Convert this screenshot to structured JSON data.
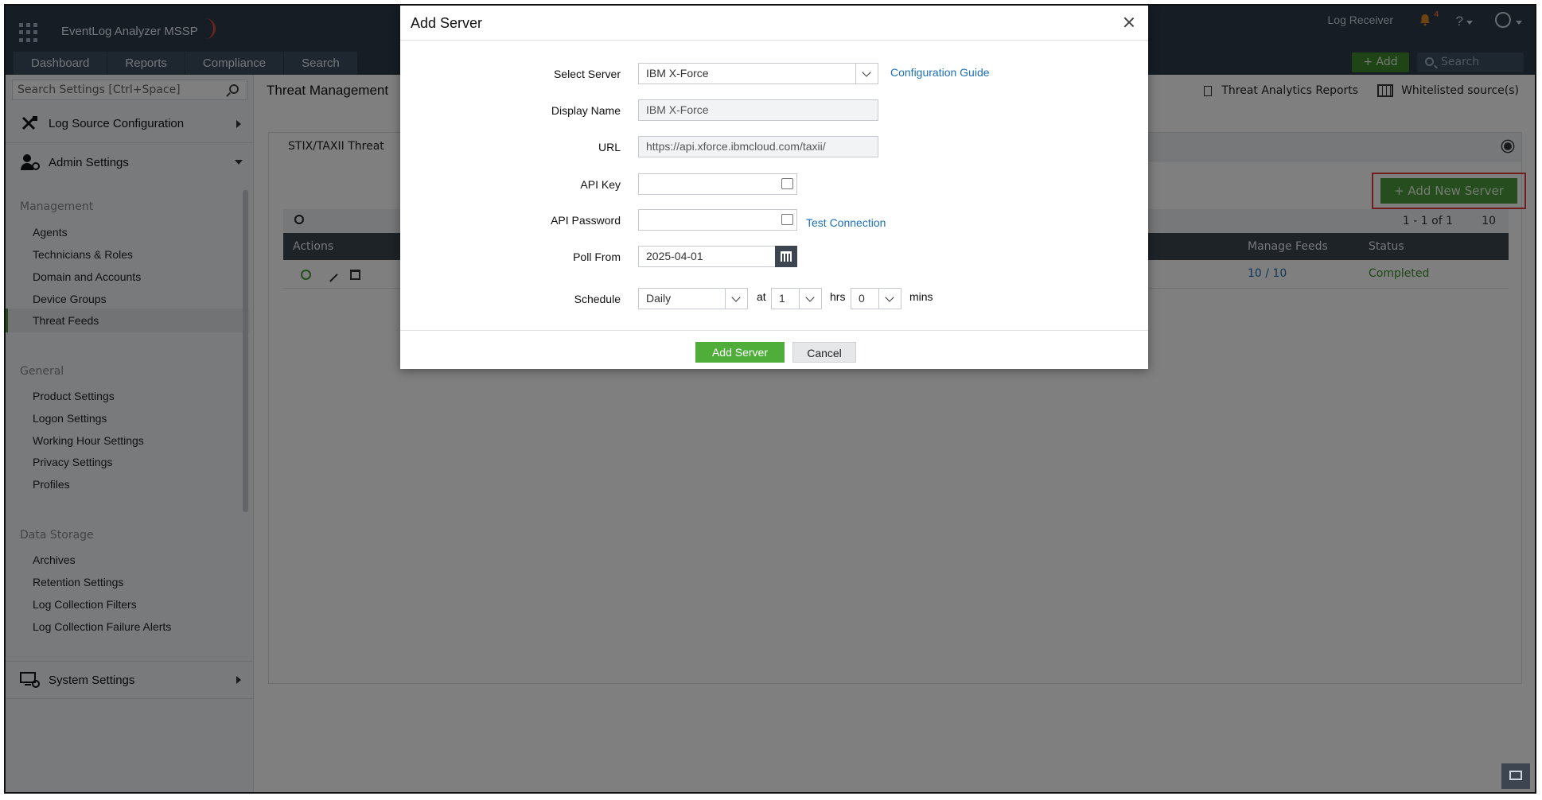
{
  "header": {
    "product": "EventLog Analyzer MSSP",
    "log_receiver": "Log Receiver",
    "notification_count": "4",
    "help": "?",
    "nav_tabs": [
      "Dashboard",
      "Reports",
      "Compliance",
      "Search"
    ],
    "add_label": "+ Add",
    "search_placeholder": "Search"
  },
  "sidebar": {
    "search_placeholder": "Search Settings [Ctrl+Space]",
    "log_source_config": "Log Source Configuration",
    "admin_settings": "Admin Settings",
    "management_title": "Management",
    "management_items": [
      "Agents",
      "Technicians & Roles",
      "Domain and Accounts",
      "Device Groups",
      "Threat Feeds"
    ],
    "general_title": "General",
    "general_items": [
      "Product Settings",
      "Logon Settings",
      "Working Hour Settings",
      "Privacy Settings",
      "Profiles"
    ],
    "data_storage_title": "Data Storage",
    "data_storage_items": [
      "Archives",
      "Retention Settings",
      "Log Collection Filters",
      "Log Collection Failure Alerts"
    ],
    "system_settings": "System Settings",
    "active_item": "Threat Feeds"
  },
  "main": {
    "title": "Threat Management",
    "threat_reports": "Threat Analytics Reports",
    "whitelisted": "Whitelisted source(s)",
    "panel_tab": "STIX/TAXII Threat",
    "add_new_server": "+  Add New Server",
    "pager": "1 - 1 of 1",
    "page_size": "10",
    "columns": {
      "actions": "Actions",
      "manage_feeds": "Manage Feeds",
      "status": "Status"
    },
    "row": {
      "manage_feeds": "10 / 10",
      "status": "Completed"
    }
  },
  "dialog": {
    "title": "Add Server",
    "select_server_label": "Select Server",
    "select_server_value": "IBM X-Force",
    "config_guide": "Configuration Guide",
    "display_name_label": "Display Name",
    "display_name_value": "IBM X-Force",
    "url_label": "URL",
    "url_value": "https://api.xforce.ibmcloud.com/taxii/",
    "api_key_label": "API Key",
    "api_password_label": "API Password",
    "test_connection": "Test Connection",
    "poll_from_label": "Poll From",
    "poll_from_value": "2025-04-01",
    "schedule_label": "Schedule",
    "schedule_value": "Daily",
    "at": "at",
    "hrs_value": "1",
    "hrs": "hrs",
    "mins_value": "0",
    "mins": "mins",
    "add_server_btn": "Add Server",
    "cancel_btn": "Cancel"
  },
  "colors": {
    "accent_green": "#4fae3a",
    "link_blue": "#1c6fb8",
    "highlight_red": "#e03a3a",
    "header_bg": "#2c3a4a"
  }
}
